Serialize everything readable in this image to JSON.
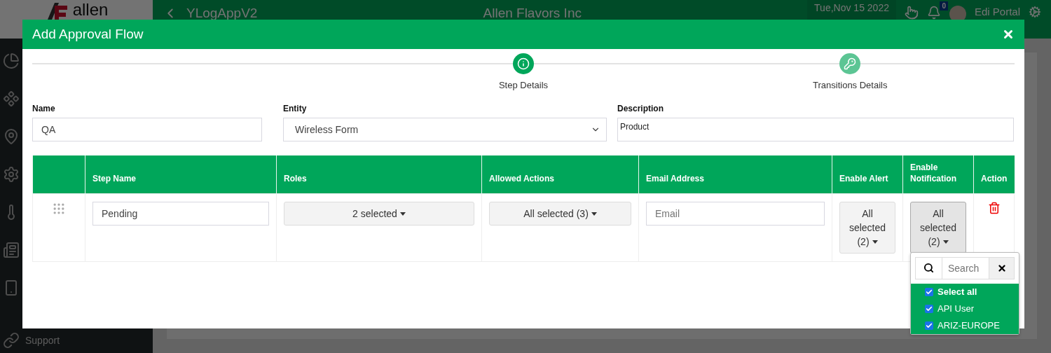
{
  "background": {
    "logo": "allen",
    "app_name": "YLogAppV2",
    "company": "Allen Flavors Inc",
    "date": "Tue,Nov 15 2022",
    "notification_count": "0",
    "user": "Edi Portal",
    "support": "Support"
  },
  "modal": {
    "title": "Add Approval Flow",
    "steps": [
      {
        "label": "Step Details",
        "selected": true,
        "kind": "info"
      },
      {
        "label": "Transitions Details",
        "selected": false,
        "kind": "key"
      }
    ],
    "fields": [
      {
        "label": "Name",
        "kind": "text",
        "value": "QA"
      },
      {
        "label": "Entity",
        "kind": "select",
        "value": "Wireless Form"
      },
      {
        "label": "Description",
        "kind": "textarea",
        "value": "Product"
      }
    ],
    "table": {
      "columns": [
        "Step Name",
        "Roles",
        "Allowed Actions",
        "Email Address",
        "Enable Alert",
        "Enable Notification",
        "Action"
      ],
      "rows": [
        {
          "step_name": "Pending",
          "roles": "2 selected",
          "allowed_actions": "All selected (3)",
          "email_placeholder": "Email",
          "enable_alert": "All selected (2)",
          "enable_notification": "All selected (2)",
          "notification_open": true
        }
      ]
    },
    "dropdown": {
      "search_placeholder": "Search",
      "options": [
        {
          "label": "Select all",
          "kind": "select_all",
          "checked": true
        },
        {
          "label": "API User",
          "kind": "option",
          "checked": true
        },
        {
          "label": "ARIZ-EUROPE",
          "kind": "option",
          "checked": true
        }
      ]
    }
  }
}
